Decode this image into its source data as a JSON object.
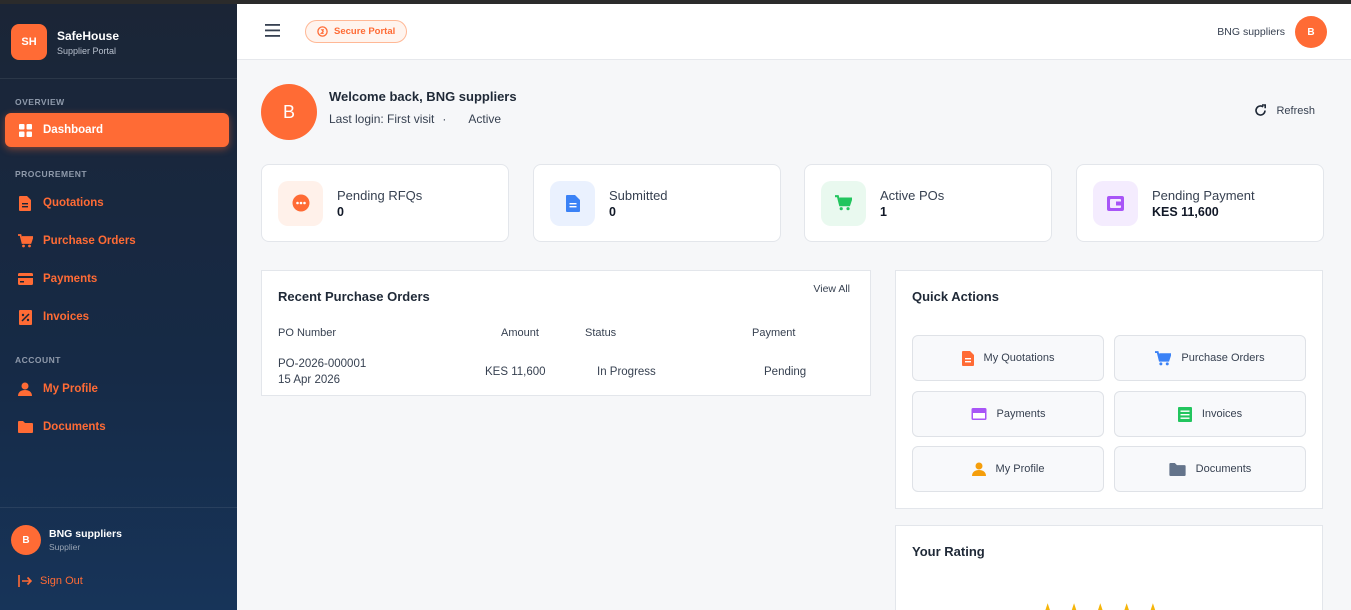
{
  "brand": {
    "initials": "SH",
    "name": "SafeHouse",
    "subtitle": "Supplier Portal"
  },
  "sidebar": {
    "sections": [
      {
        "label": "OVERVIEW"
      },
      {
        "label": "PROCUREMENT"
      },
      {
        "label": "ACCOUNT"
      }
    ],
    "items": [
      {
        "label": "Dashboard",
        "icon": "dashboard-grid-icon",
        "active": true
      },
      {
        "label": "Quotations",
        "icon": "document-icon"
      },
      {
        "label": "Purchase Orders",
        "icon": "cart-icon"
      },
      {
        "label": "Payments",
        "icon": "credit-card-icon"
      },
      {
        "label": "Invoices",
        "icon": "receipt-icon"
      },
      {
        "label": "My Profile",
        "icon": "user-icon"
      },
      {
        "label": "Documents",
        "icon": "folder-icon"
      }
    ],
    "user": {
      "initial": "B",
      "name": "BNG suppliers",
      "role": "Supplier"
    },
    "signout": "Sign Out"
  },
  "topbar": {
    "secure_label": "Secure Portal",
    "user_name": "BNG suppliers",
    "user_initial": "B"
  },
  "welcome": {
    "initial": "B",
    "title": "Welcome back, BNG suppliers",
    "last_login": "Last login: First visit",
    "dot": "·",
    "status": "Active",
    "refresh": "Refresh"
  },
  "stats": [
    {
      "label": "Pending RFQs",
      "value": "0",
      "icon": "more-dots-icon",
      "color": "#ff6b35",
      "bg": "#fff1ea"
    },
    {
      "label": "Submitted",
      "value": "0",
      "icon": "file-icon",
      "color": "#3b82f6",
      "bg": "#eaf1fe"
    },
    {
      "label": "Active POs",
      "value": "1",
      "icon": "cart-icon",
      "color": "#22c55e",
      "bg": "#e9f9ef"
    },
    {
      "label": "Pending Payment",
      "value": "KES 11,600",
      "icon": "wallet-icon",
      "color": "#a855f7",
      "bg": "#f4ecfe"
    }
  ],
  "recent_orders": {
    "title": "Recent Purchase Orders",
    "view_all": "View All",
    "columns": [
      "PO Number",
      "Amount",
      "Status",
      "Payment"
    ],
    "rows": [
      {
        "po": "PO-2026-000001",
        "date": "15 Apr 2026",
        "amount": "KES 11,600",
        "status": "In Progress",
        "payment": "Pending"
      }
    ]
  },
  "quick_actions": {
    "title": "Quick Actions",
    "buttons": [
      {
        "label": "My Quotations",
        "icon": "document-icon",
        "color": "#ff6b35"
      },
      {
        "label": "Purchase Orders",
        "icon": "cart-icon",
        "color": "#3b82f6"
      },
      {
        "label": "Payments",
        "icon": "credit-card-icon",
        "color": "#a855f7"
      },
      {
        "label": "Invoices",
        "icon": "invoice-icon",
        "color": "#22c55e"
      },
      {
        "label": "My Profile",
        "icon": "user-icon",
        "color": "#f59e0b"
      },
      {
        "label": "Documents",
        "icon": "folder-icon",
        "color": "#64748b"
      }
    ]
  },
  "rating": {
    "title": "Your Rating",
    "stars": 5
  },
  "colors": {
    "accent": "#ff6b35",
    "sidebar_bg": "#1b2536"
  }
}
